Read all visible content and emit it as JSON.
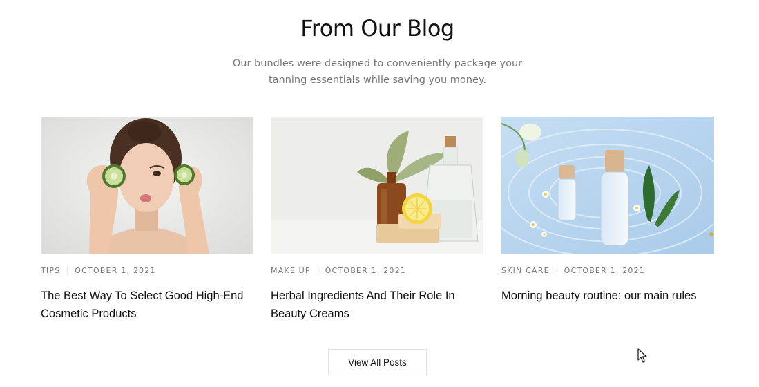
{
  "section": {
    "title": "From Our Blog",
    "subtitle": "Our bundles were designed to conveniently package your tanning essentials while saving you money."
  },
  "posts": [
    {
      "category": "TIPS",
      "separator": "|",
      "date": "OCTOBER 1, 2021",
      "title": "The Best Way To Select Good High-End Cosmetic Products",
      "image": "woman-with-cucumber-slices-photo"
    },
    {
      "category": "MAKE UP",
      "separator": "|",
      "date": "OCTOBER 1, 2021",
      "title": "Herbal Ingredients And Their Role In Beauty Creams",
      "image": "herbal-bottles-lemon-soap-photo"
    },
    {
      "category": "SKIN CARE",
      "separator": "|",
      "date": "OCTOBER 1, 2021",
      "title": "Morning beauty routine: our main rules",
      "image": "cosmetic-bottles-in-water-photo"
    }
  ],
  "actions": {
    "view_all_label": "View All Posts"
  },
  "colors": {
    "text": "#111111",
    "muted": "#777777",
    "border": "#e2e2e2",
    "water": "#cfe3f5"
  }
}
